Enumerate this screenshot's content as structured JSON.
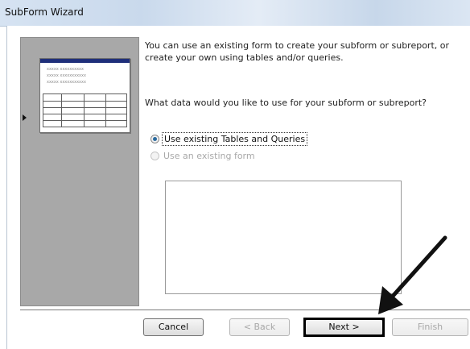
{
  "window": {
    "title": "SubForm Wizard"
  },
  "preview_panel": {
    "lines": [
      "xxxxx xxxxxxxxxx",
      "xxxxx xxxxxxxxxxx",
      "xxxxx xxxxxxxxxxx"
    ]
  },
  "content": {
    "intro_line1": "You can use an existing form to create your subform or subreport, or",
    "intro_line2": "create your own using tables and/or queries.",
    "question": "What data would you like to use for your subform or subreport?"
  },
  "options": [
    {
      "label": "Use existing Tables and Queries",
      "checked": true,
      "enabled": true
    },
    {
      "label": "Use an existing form",
      "checked": false,
      "enabled": false
    }
  ],
  "buttons": {
    "cancel": "Cancel",
    "back": "< Back",
    "next": "Next >",
    "finish": "Finish"
  },
  "colors": {
    "arrow": "#111111",
    "titlebar": "#d6e3f2",
    "panel": "#a8a8a8"
  }
}
